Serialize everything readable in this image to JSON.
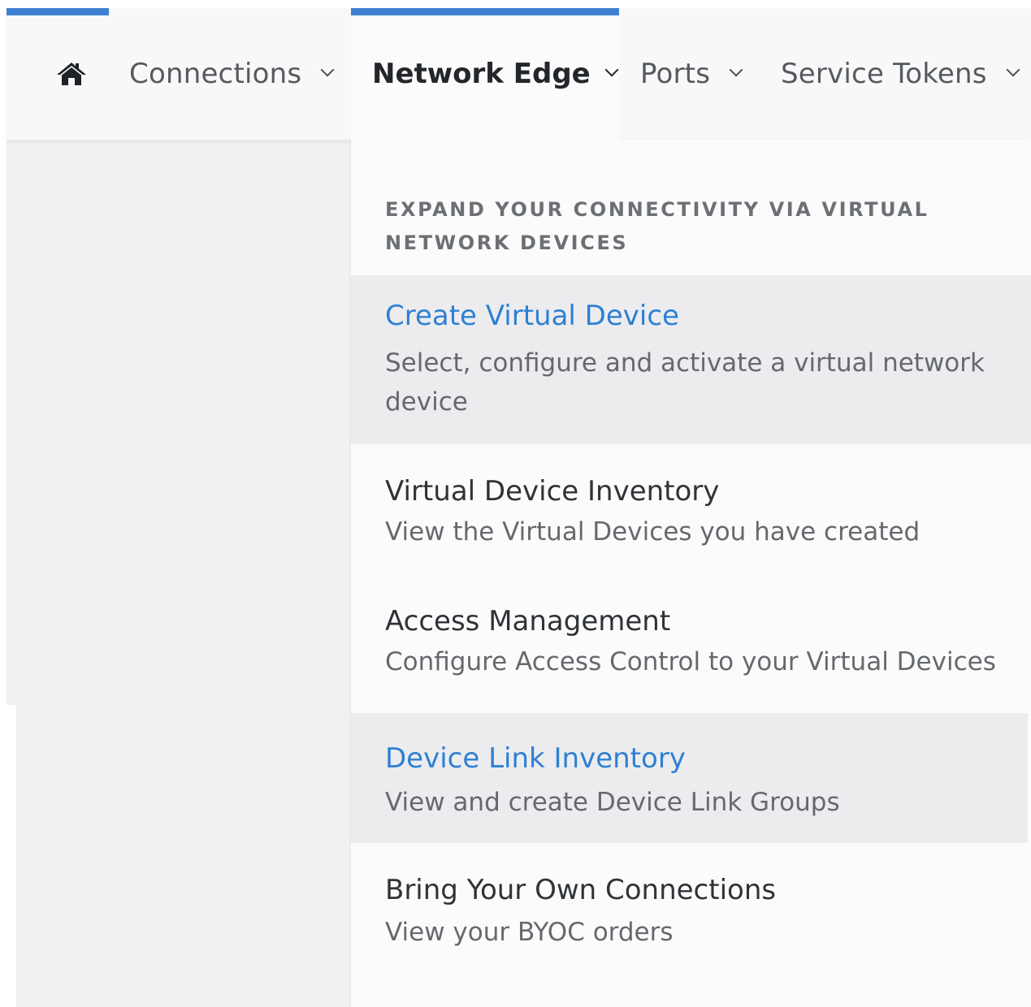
{
  "nav": {
    "home_icon": "home-icon",
    "items": [
      {
        "label": "Connections"
      },
      {
        "label": "Network Edge",
        "active": true
      },
      {
        "label": "Ports"
      },
      {
        "label": "Service Tokens"
      }
    ],
    "accent_color": "#3f7fd1"
  },
  "menu": {
    "heading": "EXPAND YOUR CONNECTIVITY VIA VIRTUAL NETWORK DEVICES",
    "items": [
      {
        "title": "Create Virtual Device",
        "description": "Select, configure and activate a virtual network device",
        "highlighted": true
      },
      {
        "title": "Virtual Device Inventory",
        "description": "View the Virtual Devices you have created",
        "highlighted": false
      },
      {
        "title": "Access Management",
        "description": "Configure Access Control to your Virtual Devices",
        "highlighted": false
      },
      {
        "title": "Device Link Inventory",
        "description": "View and create Device Link Groups",
        "highlighted": true
      },
      {
        "title": "Bring Your Own Connections",
        "description": "View your BYOC orders",
        "highlighted": false
      }
    ],
    "link_color": "#2f80d2",
    "highlight_bg": "#ececef"
  }
}
